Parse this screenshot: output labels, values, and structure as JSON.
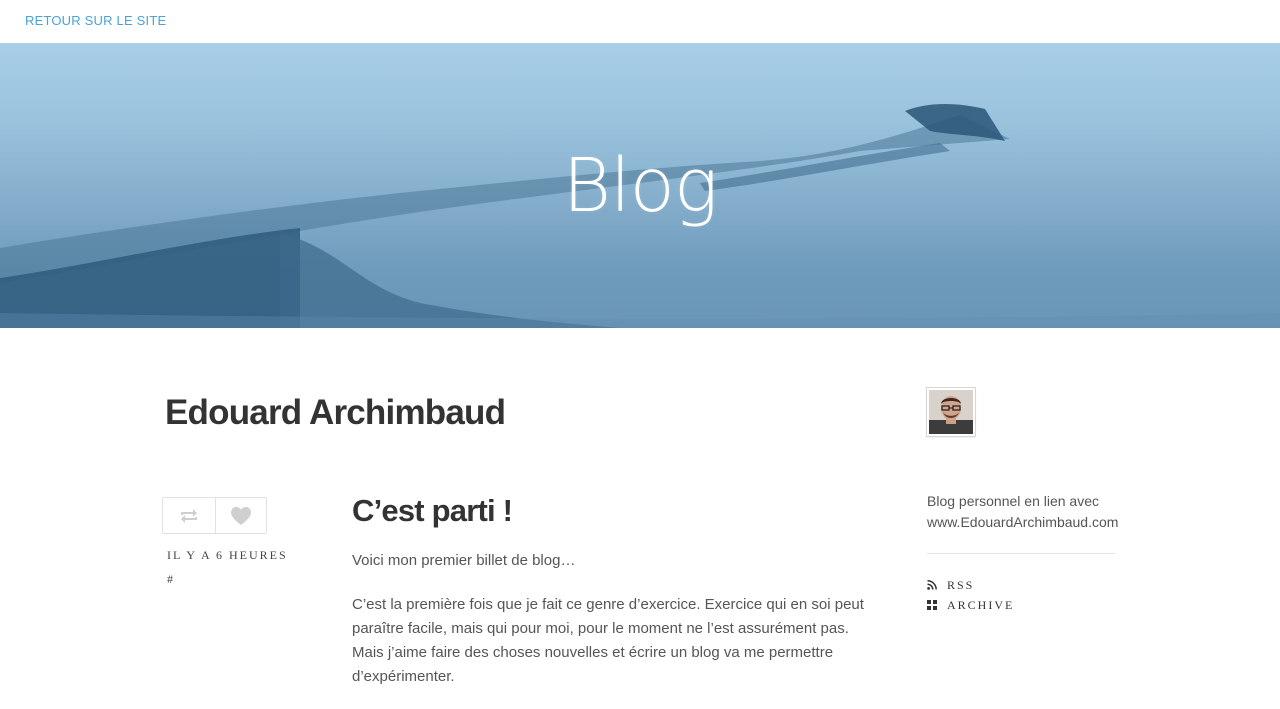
{
  "topbar": {
    "back_link": "RETOUR SUR LE SITE"
  },
  "hero": {
    "title": "Blog"
  },
  "blog": {
    "author": "Edouard Archimbaud"
  },
  "post": {
    "title": "C’est parti !",
    "time": "IL Y A 6 HEURES",
    "permalink": "#",
    "paragraphs": [
      "Voici mon premier billet de blog…",
      "C’est la première fois que je fait ce genre d’exercice. Exercice qui en soi peut paraître facile, mais qui pour moi, pour le moment ne l’est assurément pas. Mais j’aime faire des choses nouvelles et écrire un blog va me permettre d’expérimenter."
    ],
    "actions": {
      "reblog_icon": "reblog-icon",
      "like_icon": "heart-icon"
    }
  },
  "sidebar": {
    "bio": "Blog personnel en lien avec www.EdouardArchimbaud.com",
    "links": [
      {
        "label": "RSS",
        "icon": "rss-icon"
      },
      {
        "label": "ARCHIVE",
        "icon": "archive-grid-icon"
      }
    ]
  },
  "colors": {
    "link": "#4aa3d6",
    "text": "#333333",
    "muted": "#555555",
    "hero_top": "#a9cfe7",
    "hero_bottom": "#6a95b6"
  }
}
